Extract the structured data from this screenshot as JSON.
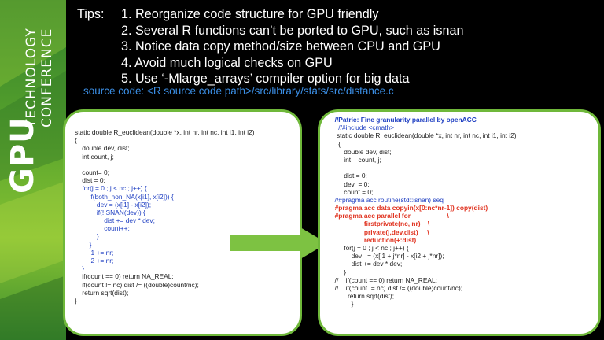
{
  "brand": {
    "line1": "GPU",
    "line2": "TECHNOLOGY",
    "line3": "CONFERENCE"
  },
  "tips": {
    "label": "Tips:",
    "items": [
      "1. Reorganize code structure for GPU friendly",
      "2. Several R functions can’t be ported to GPU, such as isnan",
      "3. Notice data copy method/size between CPU and GPU",
      "4. Avoid much logical checks on GPU",
      "5. Use ‘-Mlarge_arrays’ compiler option for big data"
    ]
  },
  "source_line": "source code: <R source code path>/src/library/stats/src/distance.c",
  "left_code": [
    {
      "text": "static double R_euclidean(double *x, int nr, int nc, int i1, int i2)",
      "style": ""
    },
    {
      "text": "{",
      "style": ""
    },
    {
      "text": "    double dev, dist;",
      "style": ""
    },
    {
      "text": "    int count, j;",
      "style": ""
    },
    {
      "text": "",
      "style": ""
    },
    {
      "text": "    count= 0;",
      "style": ""
    },
    {
      "text": "    dist = 0;",
      "style": ""
    },
    {
      "text": "    for(j = 0 ; j < nc ; j++) {",
      "style": "blue"
    },
    {
      "text": "        if(both_non_NA(x[i1], x[i2])) {",
      "style": "blue"
    },
    {
      "text": "            dev = (x[i1] - x[i2]);",
      "style": "blue"
    },
    {
      "text": "            if(!ISNAN(dev)) {",
      "style": "blue"
    },
    {
      "text": "                dist += dev * dev;",
      "style": "blue"
    },
    {
      "text": "                count++;",
      "style": "blue"
    },
    {
      "text": "            }",
      "style": "blue"
    },
    {
      "text": "        }",
      "style": "blue"
    },
    {
      "text": "        i1 += nr;",
      "style": "blue"
    },
    {
      "text": "        i2 += nr;",
      "style": "blue"
    },
    {
      "text": "    }",
      "style": "blue"
    },
    {
      "text": "    if(count == 0) return NA_REAL;",
      "style": ""
    },
    {
      "text": "    if(count != nc) dist /= ((double)count/nc);",
      "style": ""
    },
    {
      "text": "    return sqrt(dist);",
      "style": ""
    },
    {
      "text": "}",
      "style": ""
    }
  ],
  "right_code": [
    {
      "text": "  //Patric: Fine granularity parallel by openACC",
      "style": "blue bold"
    },
    {
      "text": "    //#include <cmath>",
      "style": "blue"
    },
    {
      "text": "   static double R_euclidean(double *x, int nr, int nc, int i1, int i2)",
      "style": ""
    },
    {
      "text": "    {",
      "style": ""
    },
    {
      "text": "       double dev, dist;",
      "style": ""
    },
    {
      "text": "       int    count, j;",
      "style": ""
    },
    {
      "text": "",
      "style": ""
    },
    {
      "text": "       dist = 0;",
      "style": ""
    },
    {
      "text": "       dev  = 0;",
      "style": ""
    },
    {
      "text": "       count = 0;",
      "style": ""
    },
    {
      "text": "  //#pragma acc routine(std::isnan) seq",
      "style": "blue"
    },
    {
      "text": "  #pragma acc data copyin(x[0:nc*nr-1]) copy(dist)",
      "style": "red bold"
    },
    {
      "text": "  #pragma acc parallel for                    \\",
      "style": "red bold"
    },
    {
      "text": "                  firstprivate(nc, nr)    \\",
      "style": "red bold"
    },
    {
      "text": "                  private(j,dev,dist)     \\",
      "style": "red bold"
    },
    {
      "text": "                  reduction(+:dist)",
      "style": "red bold"
    },
    {
      "text": "       for(j = 0 ; j < nc ; j++) {",
      "style": ""
    },
    {
      "text": "           dev   = (x[i1 + j*nr] - x[i2 + j*nr]);",
      "style": ""
    },
    {
      "text": "           dist += dev * dev;",
      "style": ""
    },
    {
      "text": "       }",
      "style": ""
    },
    {
      "text": "  //    if(count == 0) return NA_REAL;",
      "style": ""
    },
    {
      "text": "  //    if(count != nc) dist /= ((double)count/nc);",
      "style": ""
    },
    {
      "text": "         return sqrt(dist);",
      "style": ""
    },
    {
      "text": "           }",
      "style": ""
    }
  ],
  "colors": {
    "accent_green": "#6fb83a",
    "arrow_green": "#7dc242",
    "source_blue": "#3b8fe6"
  }
}
